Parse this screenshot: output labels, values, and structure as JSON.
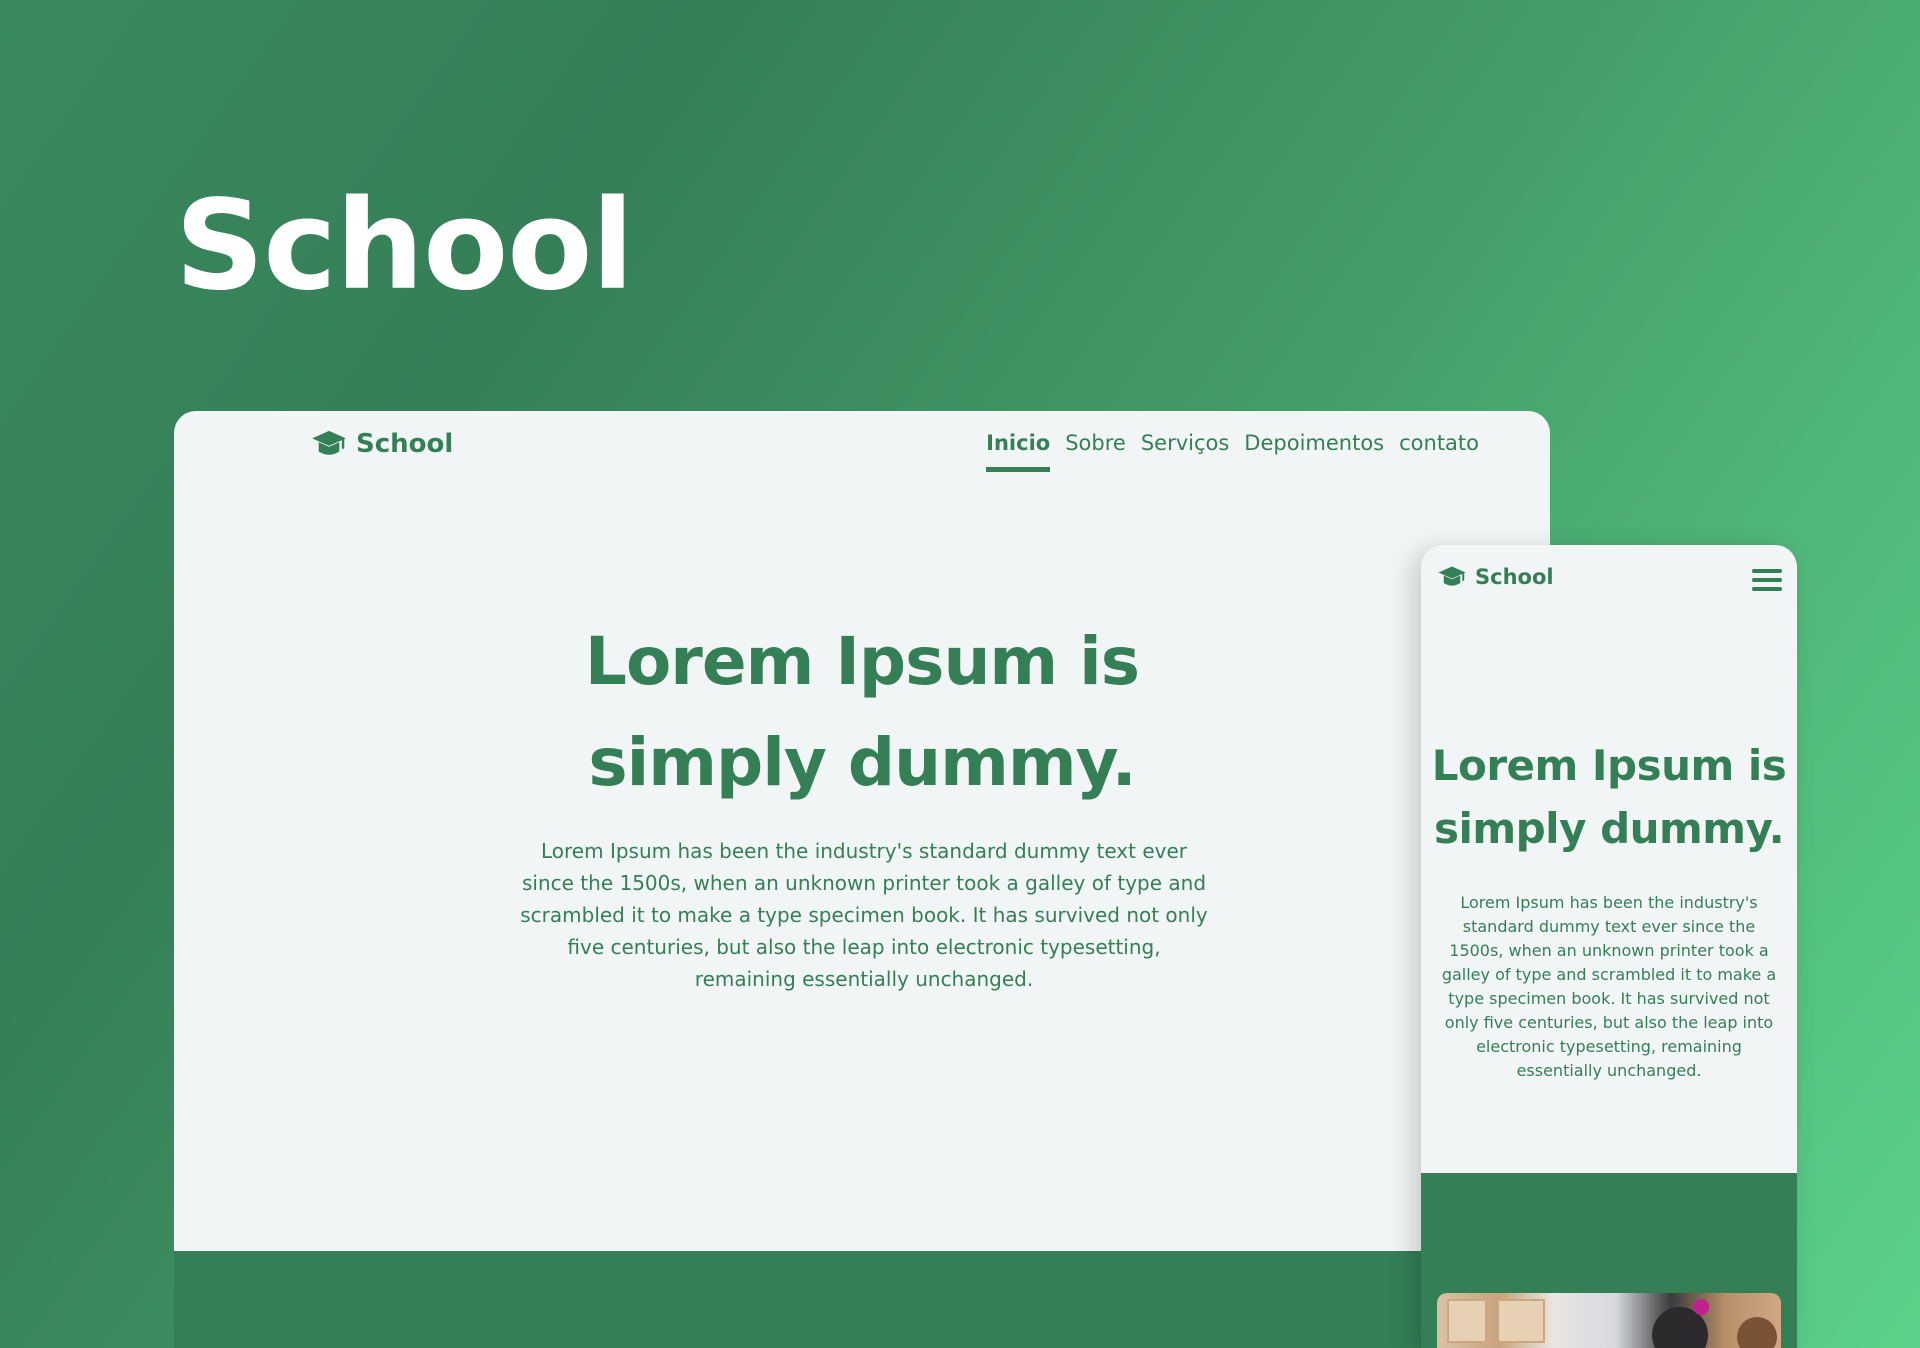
{
  "showcase": {
    "title": "School"
  },
  "colors": {
    "brand_green": "#347f56",
    "page_background": "#f2f5f5",
    "showcase_gradient_start": "#357f57",
    "showcase_gradient_end": "#5ad18a"
  },
  "desktop": {
    "brand": {
      "icon": "graduation-cap-icon",
      "name": "School"
    },
    "nav": {
      "items": [
        {
          "label": "Inicio",
          "active": true
        },
        {
          "label": "Sobre",
          "active": false
        },
        {
          "label": "Serviços",
          "active": false
        },
        {
          "label": "Depoimentos",
          "active": false
        },
        {
          "label": "contato",
          "active": false
        }
      ]
    },
    "hero": {
      "title_line1": "Lorem Ipsum is",
      "title_line2": "simply dummy.",
      "text": "Lorem Ipsum has been the industry's standard dummy text ever since the 1500s, when an unknown printer took a galley of type and scrambled it to make a type specimen book. It has survived not only five centuries, but also the leap into electronic typesetting, remaining essentially unchanged."
    }
  },
  "mobile": {
    "brand": {
      "icon": "graduation-cap-icon",
      "name": "School"
    },
    "menu_icon": "hamburger-menu-icon",
    "hero": {
      "title_line1": "Lorem Ipsum is",
      "title_line2": "simply dummy.",
      "text": "Lorem Ipsum has been the industry's standard dummy text ever since the 1500s, when an unknown printer took a galley of type and scrambled it to make a type specimen book. It has survived not only five centuries, but also the leap into electronic typesetting, remaining essentially unchanged."
    }
  }
}
